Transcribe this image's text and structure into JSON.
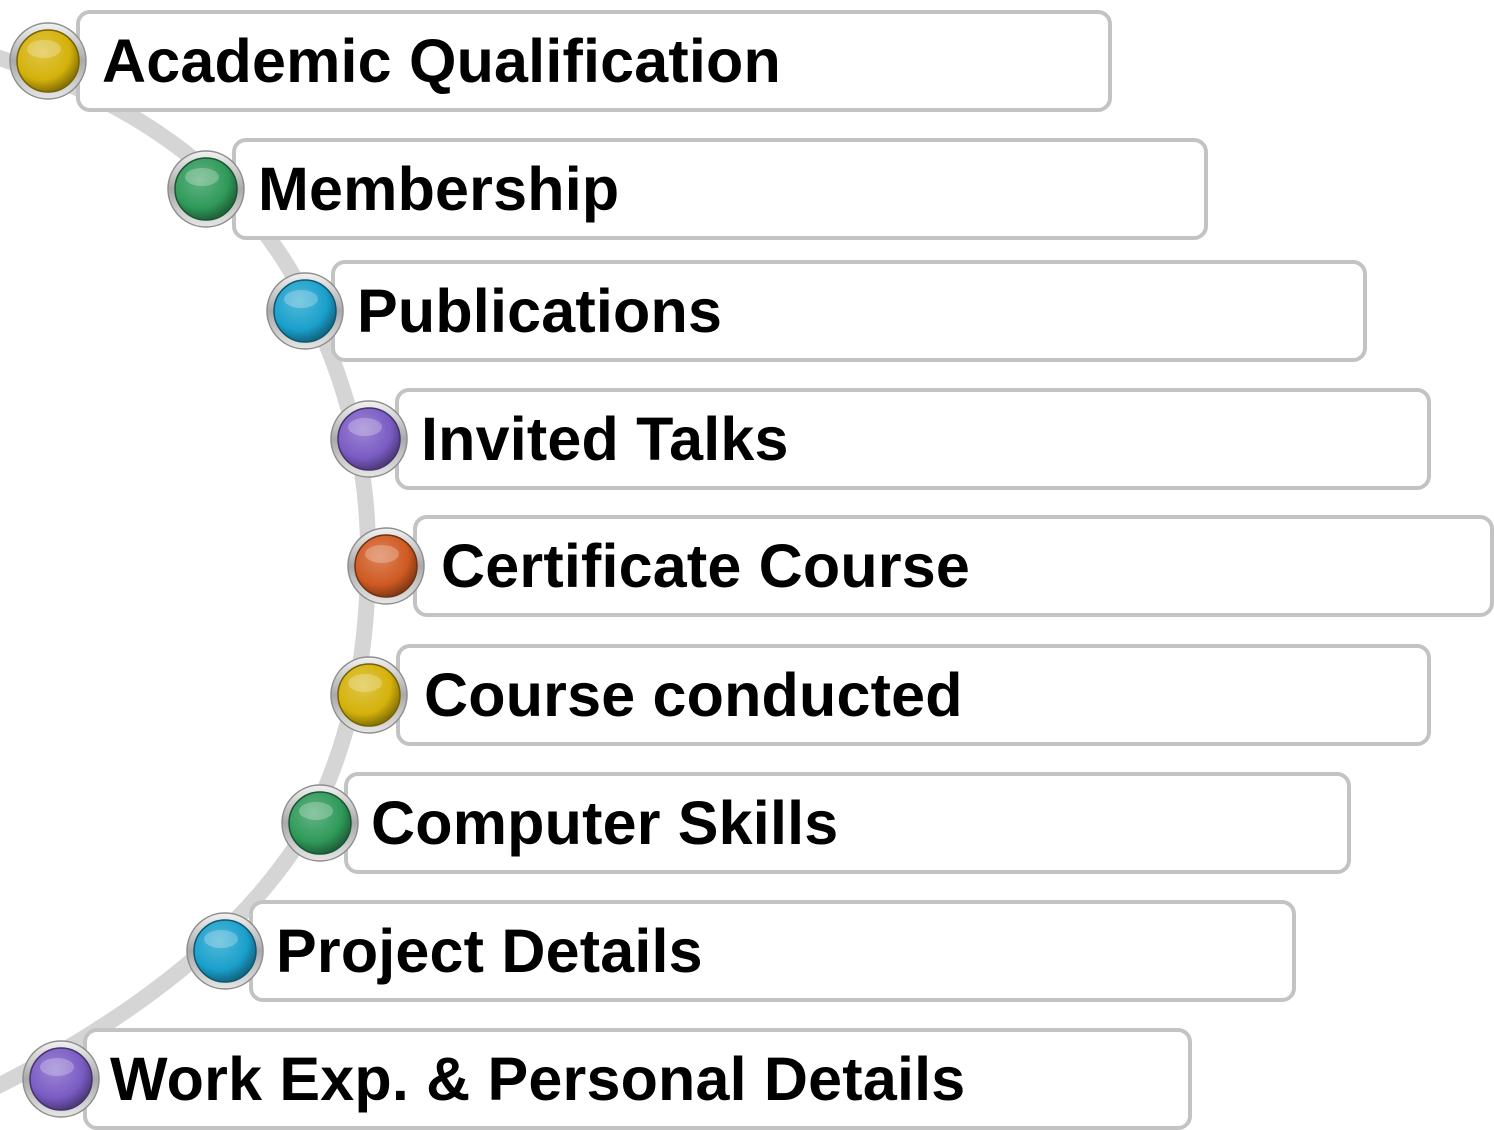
{
  "items": [
    {
      "label": "Academic Qualification",
      "color": "#d4b20a"
    },
    {
      "label": "Membership",
      "color": "#2f9a5a"
    },
    {
      "label": "Publications",
      "color": "#1aa0cc"
    },
    {
      "label": "Invited Talks",
      "color": "#7b5cc4"
    },
    {
      "label": "Certificate Course",
      "color": "#d05a22"
    },
    {
      "label": "Course conducted",
      "color": "#d4b20a"
    },
    {
      "label": "Computer Skills",
      "color": "#2f9a5a"
    },
    {
      "label": "Project Details",
      "color": "#1aa0cc"
    },
    {
      "label": "Work Exp. & Personal Details",
      "color": "#7b5cc4"
    }
  ]
}
